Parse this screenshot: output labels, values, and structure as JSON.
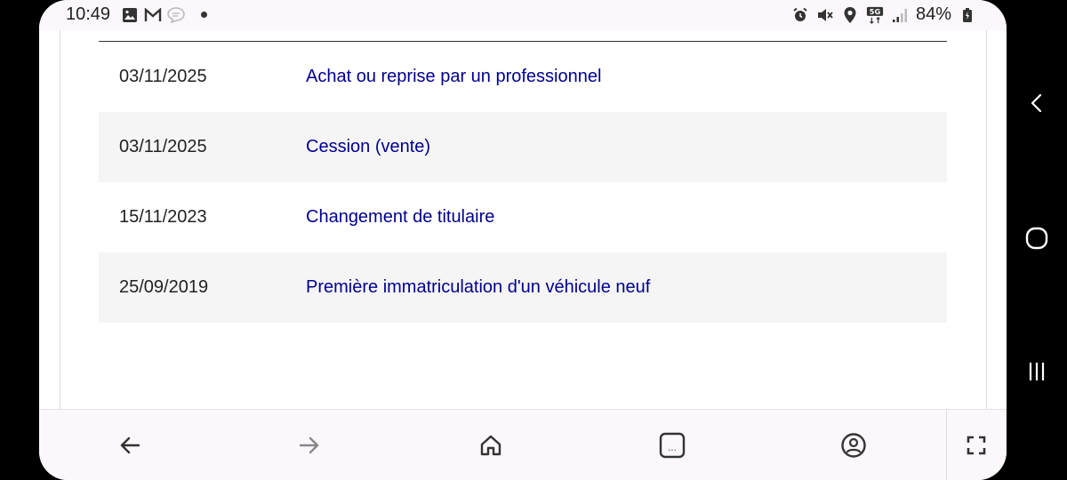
{
  "status_bar": {
    "time": "10:49",
    "left_icons": [
      "gallery-icon",
      "gmail-icon",
      "messages-icon"
    ],
    "right_icons": [
      "alarm-icon",
      "mute-vibrate-icon",
      "location-icon",
      "5g-icon",
      "signal-icon"
    ],
    "network": "5G",
    "battery": "84%"
  },
  "history_table": {
    "rows": [
      {
        "date": "03/11/2025",
        "event": "Achat ou reprise par un professionnel"
      },
      {
        "date": "03/11/2025",
        "event": "Cession (vente)"
      },
      {
        "date": "15/11/2023",
        "event": "Changement de titulaire"
      },
      {
        "date": "25/09/2019",
        "event": "Première immatriculation d'un véhicule neuf"
      }
    ]
  },
  "toolbar": {
    "buttons": [
      "back-icon",
      "forward-icon",
      "home-icon",
      "tabs-icon",
      "account-icon",
      "fullscreen-icon"
    ],
    "tabs_label": "..."
  },
  "android_nav": [
    "nav-back-icon",
    "nav-home-icon",
    "nav-recents-icon"
  ],
  "colors": {
    "link": "#000091",
    "row_alt": "#f5f5f5",
    "bar_bg": "#fbf7fb"
  }
}
